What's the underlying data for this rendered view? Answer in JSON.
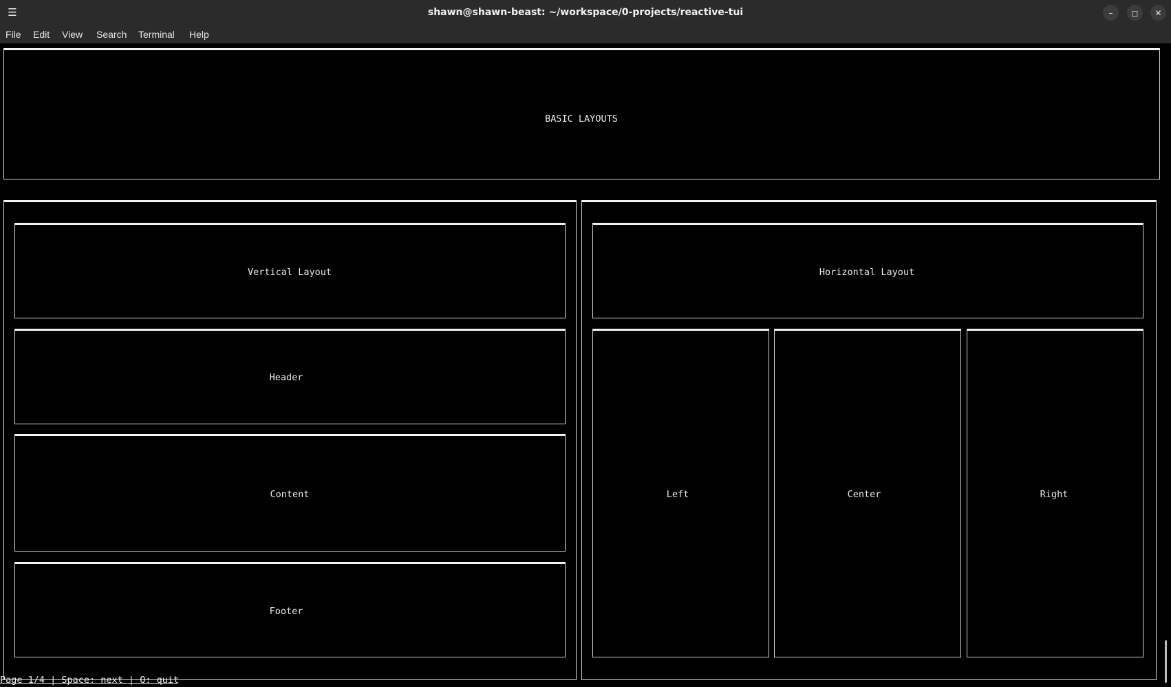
{
  "window": {
    "title": "shawn@shawn-beast: ~/workspace/0-projects/reactive-tui",
    "menu_icon": "hamburger-menu-icon",
    "minimize_icon": "minimize-icon",
    "maximize_icon": "maximize-icon",
    "close_icon": "close-icon",
    "minimize_glyph": "–",
    "maximize_glyph": "◻",
    "close_glyph": "✕",
    "menu_glyph": "☰"
  },
  "menubar": {
    "items": [
      "File",
      "Edit",
      "View",
      "Search",
      "Terminal",
      "Help"
    ]
  },
  "tui": {
    "title": "BASIC LAYOUTS",
    "vertical": {
      "label": "Vertical Layout",
      "header": "Header",
      "content": "Content",
      "footer": "Footer"
    },
    "horizontal": {
      "label": "Horizontal Layout",
      "left": "Left",
      "center": "Center",
      "right": "Right"
    },
    "status": "Page 1/4 | Space: next | Q: quit"
  },
  "colors": {
    "titlebar_bg": "#2b2b2b",
    "terminal_bg": "#000000",
    "terminal_fg": "#ececec",
    "border": "#d6d6d6"
  }
}
